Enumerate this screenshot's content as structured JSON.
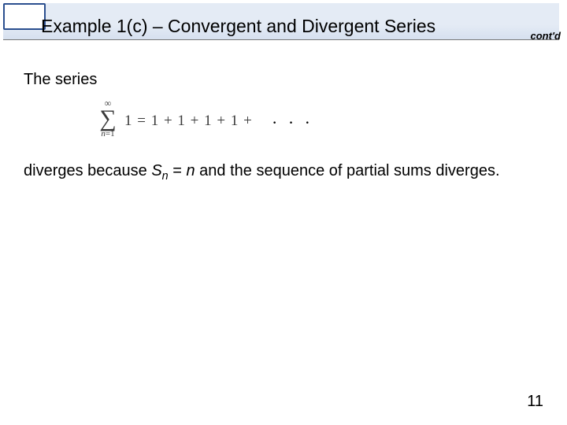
{
  "header": {
    "title": "Example 1(c) – Convergent and Divergent Series",
    "contd": "cont'd"
  },
  "body": {
    "line1": "The series",
    "formula": {
      "upper": "∞",
      "sigma": "∑",
      "lower_var": "n",
      "lower_eq": "=",
      "lower_val": "1",
      "rhs": "1 = 1 + 1 + 1 + 1 +",
      "dots": "· · ·"
    },
    "para_pre": "diverges because ",
    "para_S": "S",
    "para_sub": "n",
    "para_mid1": " = ",
    "para_n": "n",
    "para_mid2": " and the sequence of partial sums diverges."
  },
  "page": {
    "number": "11"
  }
}
